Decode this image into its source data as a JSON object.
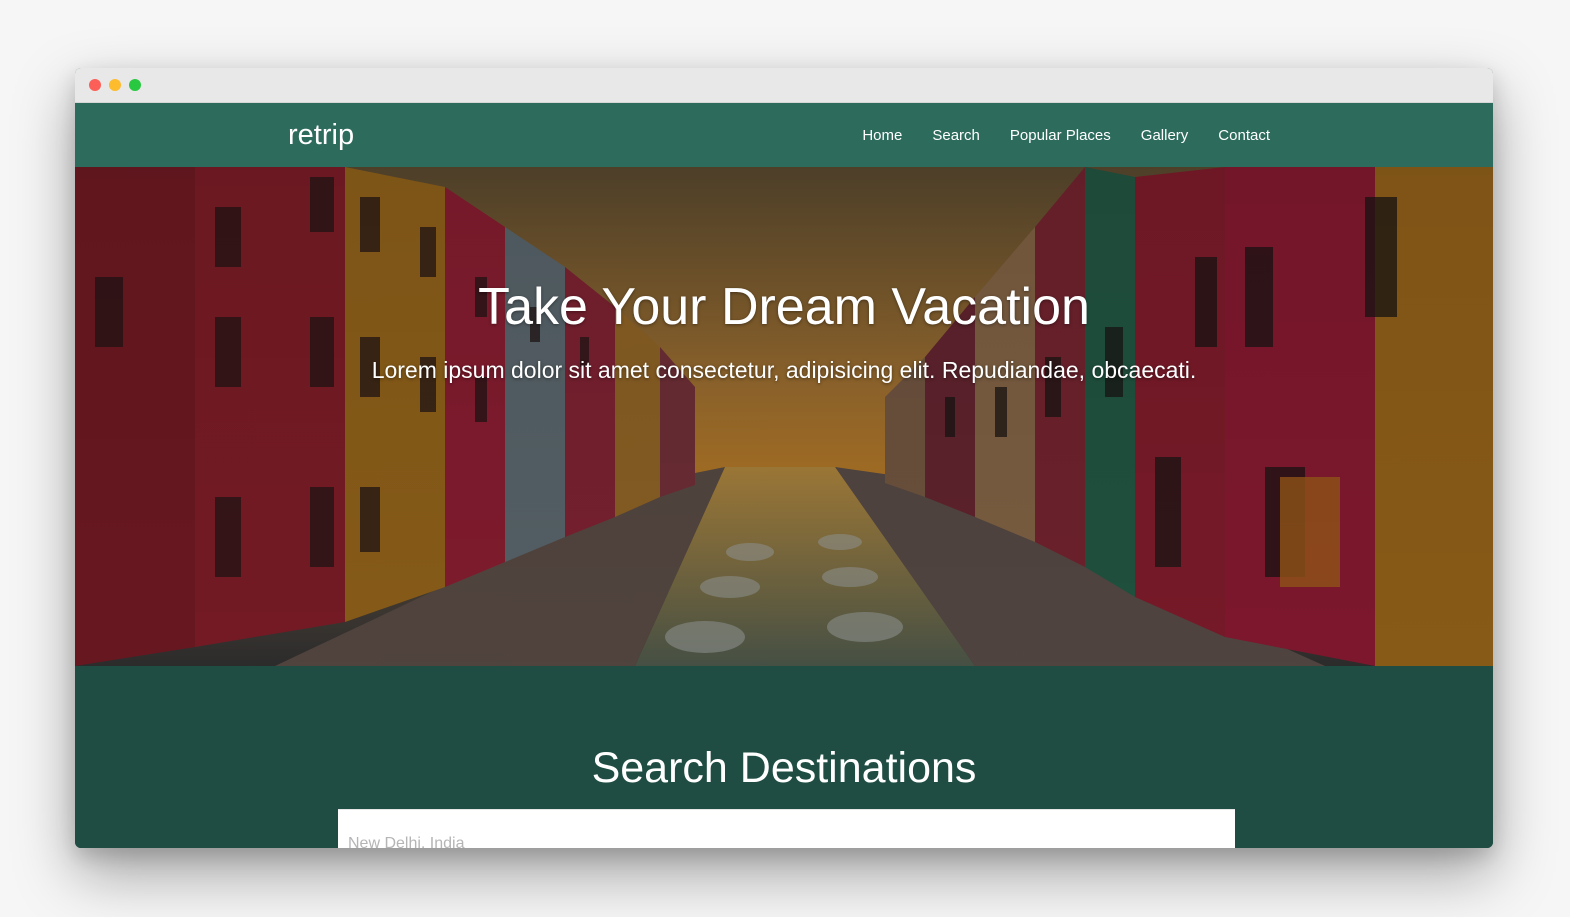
{
  "window": {
    "controls": [
      "close",
      "minimize",
      "zoom"
    ]
  },
  "navbar": {
    "brand": "retrip",
    "links": [
      "Home",
      "Search",
      "Popular Places",
      "Gallery",
      "Contact"
    ]
  },
  "hero": {
    "title": "Take Your Dream Vacation",
    "subtitle": "Lorem ipsum dolor sit amet consectetur, adipisicing elit. Repudiandae, obcaecati."
  },
  "search": {
    "title": "Search Destinations",
    "placeholder": "New Delhi, India"
  },
  "colors": {
    "navbar": "#2d6b5c",
    "section": "#1f4d43",
    "titlebar": "#e8e8e8"
  }
}
